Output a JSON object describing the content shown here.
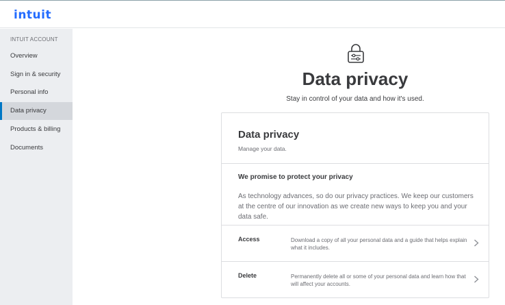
{
  "header": {
    "logo_text": "intuit"
  },
  "sidebar": {
    "heading": "INTUIT ACCOUNT",
    "items": [
      {
        "label": "Overview",
        "active": false
      },
      {
        "label": "Sign in & security",
        "active": false
      },
      {
        "label": "Personal info",
        "active": false
      },
      {
        "label": "Data privacy",
        "active": true
      },
      {
        "label": "Products & billing",
        "active": false
      },
      {
        "label": "Documents",
        "active": false
      }
    ]
  },
  "page": {
    "icon": "lock-icon",
    "title": "Data privacy",
    "subtitle": "Stay in control of your data and how it's used."
  },
  "card": {
    "title": "Data privacy",
    "subtitle": "Manage your data.",
    "promise_heading": "We promise to protect your privacy",
    "promise_body": "As technology advances, so do our privacy practices. We keep our customers at the centre of our innovation as we create new ways to keep you and your data safe.",
    "rows": [
      {
        "label": "Access",
        "description": "Download a copy of all your personal data and a guide that helps explain what it includes.",
        "icon": "chevron-right-icon"
      },
      {
        "label": "Delete",
        "description": "Permanently delete all or some of your personal data and learn how that will affect your accounts.",
        "icon": "chevron-right-icon"
      }
    ]
  },
  "colors": {
    "brand": "#236cff",
    "active_indicator": "#0077c5",
    "sidebar_bg": "#eceef1"
  }
}
